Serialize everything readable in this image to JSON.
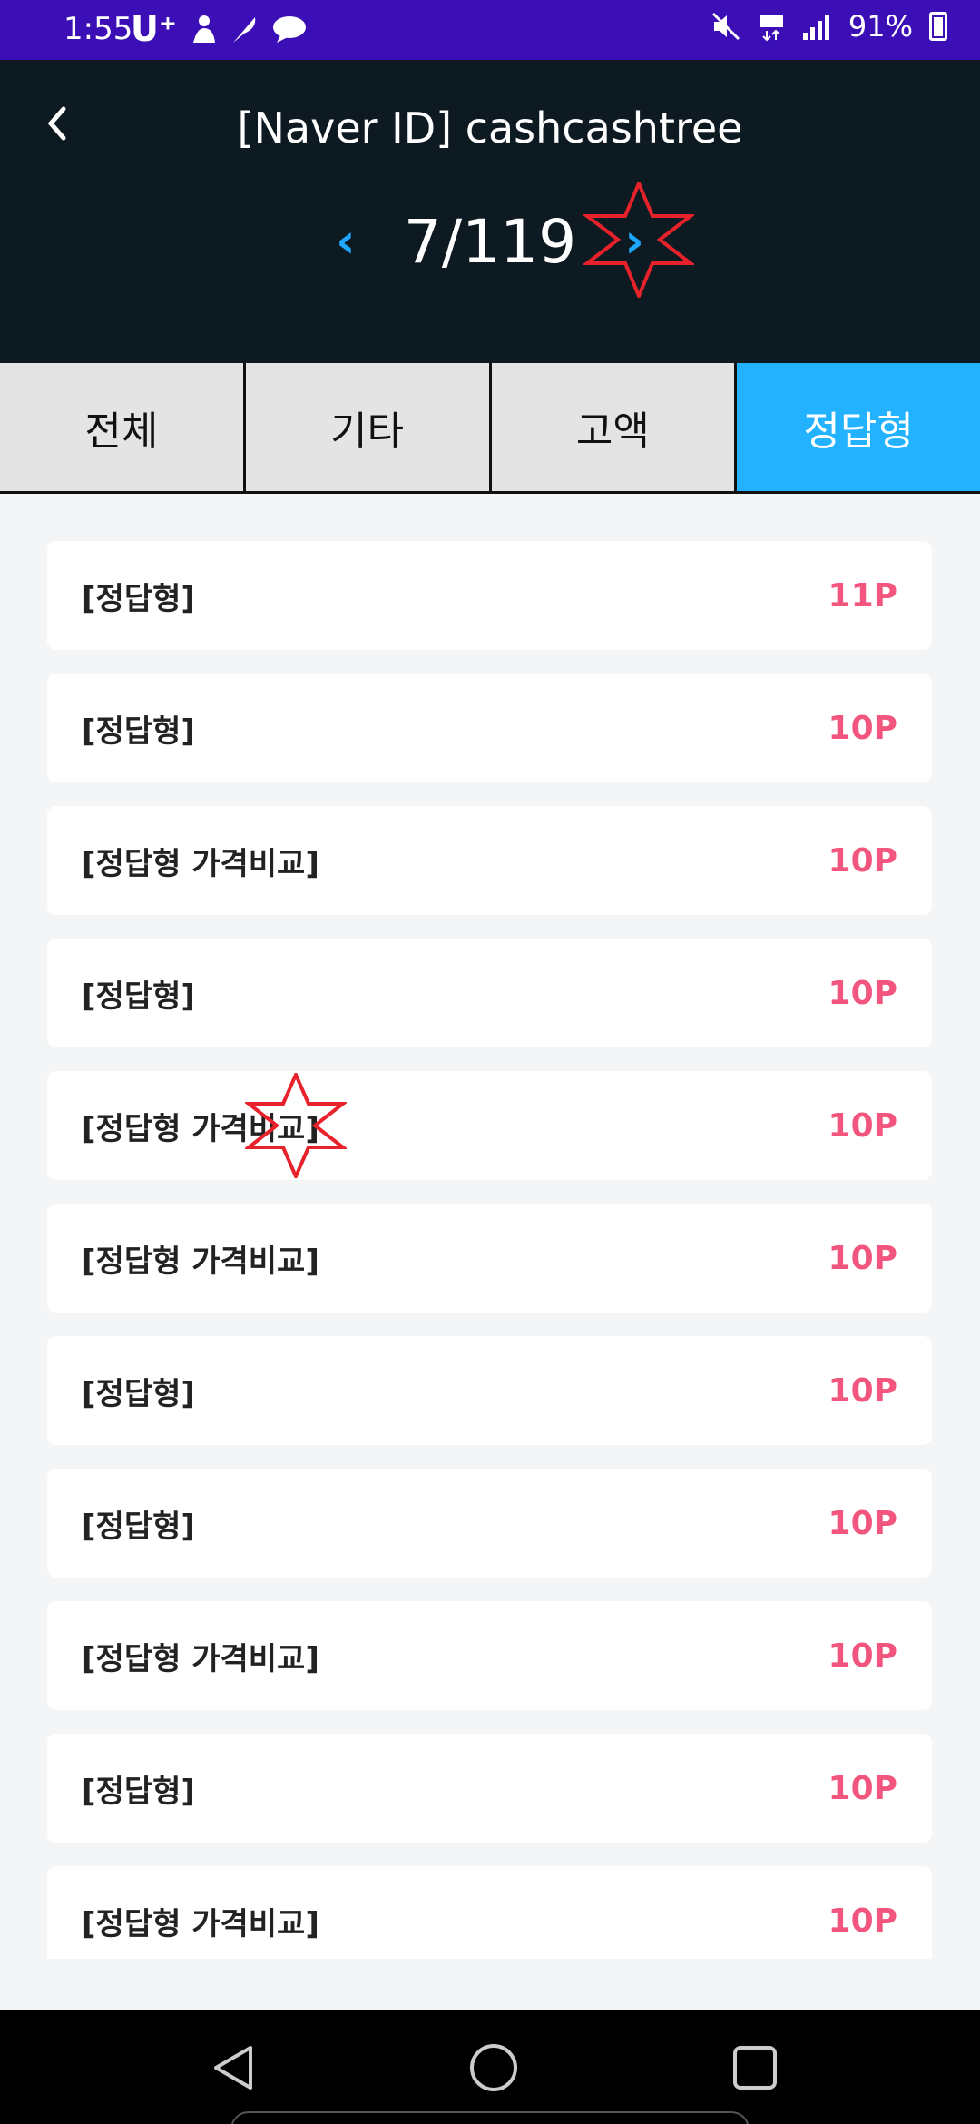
{
  "status_bar": {
    "time": "1:55",
    "carrier": "U⁺",
    "battery": "91%",
    "icons": [
      "person-icon",
      "feather-icon",
      "chat-icon",
      "mute-icon",
      "lte-icon",
      "signal-icon",
      "battery-icon"
    ]
  },
  "header": {
    "title": "[Naver ID] cashcashtree",
    "page_current": 7,
    "page_total": 119,
    "page_label": "7/119",
    "prev_arrow": "‹",
    "next_arrow": "›",
    "back_icon": "‹"
  },
  "tabs": [
    {
      "label": "전체",
      "active": false
    },
    {
      "label": "기타",
      "active": false
    },
    {
      "label": "고액",
      "active": false
    },
    {
      "label": "정답형",
      "active": true
    }
  ],
  "items": [
    {
      "label": "[정답형]",
      "points": "11P"
    },
    {
      "label": "[정답형]",
      "points": "10P"
    },
    {
      "label": "[정답형 가격비교]",
      "points": "10P"
    },
    {
      "label": "[정답형]",
      "points": "10P"
    },
    {
      "label": "[정답형 가격비교]",
      "points": "10P"
    },
    {
      "label": "[정답형 가격비교]",
      "points": "10P"
    },
    {
      "label": "[정답형]",
      "points": "10P"
    },
    {
      "label": "[정답형]",
      "points": "10P"
    },
    {
      "label": "[정답형 가격비교]",
      "points": "10P"
    },
    {
      "label": "[정답형]",
      "points": "10P"
    },
    {
      "label": "[정답형 가격비교]",
      "points": "10P"
    }
  ],
  "colors": {
    "status_bar": "#3b0fb5",
    "header_bg": "#0e1a22",
    "accent_blue": "#22b2ff",
    "points_pink": "#f2557d",
    "star_red": "#e8222a"
  }
}
